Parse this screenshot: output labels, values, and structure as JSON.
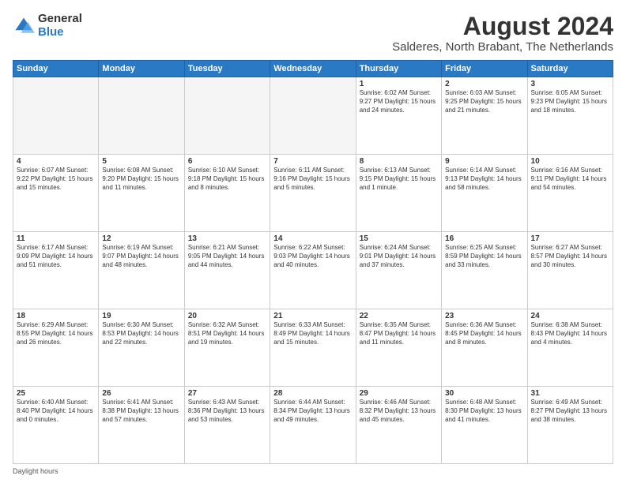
{
  "logo": {
    "general": "General",
    "blue": "Blue"
  },
  "title": {
    "month_year": "August 2024",
    "location": "Salderes, North Brabant, The Netherlands"
  },
  "headers": [
    "Sunday",
    "Monday",
    "Tuesday",
    "Wednesday",
    "Thursday",
    "Friday",
    "Saturday"
  ],
  "footer": {
    "daylight_hours": "Daylight hours"
  },
  "weeks": [
    [
      {
        "day": "",
        "info": ""
      },
      {
        "day": "",
        "info": ""
      },
      {
        "day": "",
        "info": ""
      },
      {
        "day": "",
        "info": ""
      },
      {
        "day": "1",
        "info": "Sunrise: 6:02 AM\nSunset: 9:27 PM\nDaylight: 15 hours\nand 24 minutes."
      },
      {
        "day": "2",
        "info": "Sunrise: 6:03 AM\nSunset: 9:25 PM\nDaylight: 15 hours\nand 21 minutes."
      },
      {
        "day": "3",
        "info": "Sunrise: 6:05 AM\nSunset: 9:23 PM\nDaylight: 15 hours\nand 18 minutes."
      }
    ],
    [
      {
        "day": "4",
        "info": "Sunrise: 6:07 AM\nSunset: 9:22 PM\nDaylight: 15 hours\nand 15 minutes."
      },
      {
        "day": "5",
        "info": "Sunrise: 6:08 AM\nSunset: 9:20 PM\nDaylight: 15 hours\nand 11 minutes."
      },
      {
        "day": "6",
        "info": "Sunrise: 6:10 AM\nSunset: 9:18 PM\nDaylight: 15 hours\nand 8 minutes."
      },
      {
        "day": "7",
        "info": "Sunrise: 6:11 AM\nSunset: 9:16 PM\nDaylight: 15 hours\nand 5 minutes."
      },
      {
        "day": "8",
        "info": "Sunrise: 6:13 AM\nSunset: 9:15 PM\nDaylight: 15 hours\nand 1 minute."
      },
      {
        "day": "9",
        "info": "Sunrise: 6:14 AM\nSunset: 9:13 PM\nDaylight: 14 hours\nand 58 minutes."
      },
      {
        "day": "10",
        "info": "Sunrise: 6:16 AM\nSunset: 9:11 PM\nDaylight: 14 hours\nand 54 minutes."
      }
    ],
    [
      {
        "day": "11",
        "info": "Sunrise: 6:17 AM\nSunset: 9:09 PM\nDaylight: 14 hours\nand 51 minutes."
      },
      {
        "day": "12",
        "info": "Sunrise: 6:19 AM\nSunset: 9:07 PM\nDaylight: 14 hours\nand 48 minutes."
      },
      {
        "day": "13",
        "info": "Sunrise: 6:21 AM\nSunset: 9:05 PM\nDaylight: 14 hours\nand 44 minutes."
      },
      {
        "day": "14",
        "info": "Sunrise: 6:22 AM\nSunset: 9:03 PM\nDaylight: 14 hours\nand 40 minutes."
      },
      {
        "day": "15",
        "info": "Sunrise: 6:24 AM\nSunset: 9:01 PM\nDaylight: 14 hours\nand 37 minutes."
      },
      {
        "day": "16",
        "info": "Sunrise: 6:25 AM\nSunset: 8:59 PM\nDaylight: 14 hours\nand 33 minutes."
      },
      {
        "day": "17",
        "info": "Sunrise: 6:27 AM\nSunset: 8:57 PM\nDaylight: 14 hours\nand 30 minutes."
      }
    ],
    [
      {
        "day": "18",
        "info": "Sunrise: 6:29 AM\nSunset: 8:55 PM\nDaylight: 14 hours\nand 26 minutes."
      },
      {
        "day": "19",
        "info": "Sunrise: 6:30 AM\nSunset: 8:53 PM\nDaylight: 14 hours\nand 22 minutes."
      },
      {
        "day": "20",
        "info": "Sunrise: 6:32 AM\nSunset: 8:51 PM\nDaylight: 14 hours\nand 19 minutes."
      },
      {
        "day": "21",
        "info": "Sunrise: 6:33 AM\nSunset: 8:49 PM\nDaylight: 14 hours\nand 15 minutes."
      },
      {
        "day": "22",
        "info": "Sunrise: 6:35 AM\nSunset: 8:47 PM\nDaylight: 14 hours\nand 11 minutes."
      },
      {
        "day": "23",
        "info": "Sunrise: 6:36 AM\nSunset: 8:45 PM\nDaylight: 14 hours\nand 8 minutes."
      },
      {
        "day": "24",
        "info": "Sunrise: 6:38 AM\nSunset: 8:43 PM\nDaylight: 14 hours\nand 4 minutes."
      }
    ],
    [
      {
        "day": "25",
        "info": "Sunrise: 6:40 AM\nSunset: 8:40 PM\nDaylight: 14 hours\nand 0 minutes."
      },
      {
        "day": "26",
        "info": "Sunrise: 6:41 AM\nSunset: 8:38 PM\nDaylight: 13 hours\nand 57 minutes."
      },
      {
        "day": "27",
        "info": "Sunrise: 6:43 AM\nSunset: 8:36 PM\nDaylight: 13 hours\nand 53 minutes."
      },
      {
        "day": "28",
        "info": "Sunrise: 6:44 AM\nSunset: 8:34 PM\nDaylight: 13 hours\nand 49 minutes."
      },
      {
        "day": "29",
        "info": "Sunrise: 6:46 AM\nSunset: 8:32 PM\nDaylight: 13 hours\nand 45 minutes."
      },
      {
        "day": "30",
        "info": "Sunrise: 6:48 AM\nSunset: 8:30 PM\nDaylight: 13 hours\nand 41 minutes."
      },
      {
        "day": "31",
        "info": "Sunrise: 6:49 AM\nSunset: 8:27 PM\nDaylight: 13 hours\nand 38 minutes."
      }
    ]
  ]
}
